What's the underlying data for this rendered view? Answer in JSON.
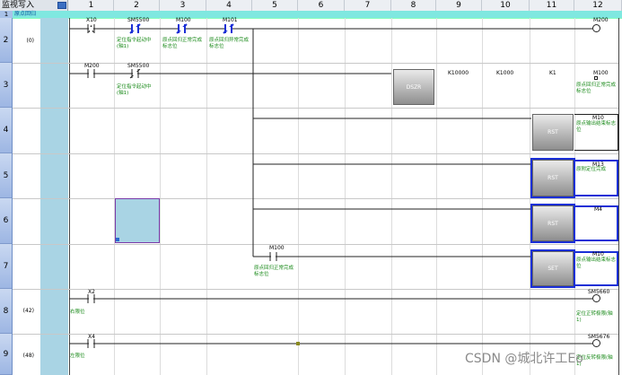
{
  "header": {
    "mode_label": "监视写入",
    "columns": [
      "1",
      "2",
      "3",
      "4",
      "5",
      "6",
      "7",
      "8",
      "9",
      "10",
      "11",
      "12"
    ]
  },
  "comment_row": {
    "num": "1",
    "text": "原点回归"
  },
  "rows": [
    {
      "num": "2",
      "step": "(0)"
    },
    {
      "num": "3",
      "step": ""
    },
    {
      "num": "4",
      "step": ""
    },
    {
      "num": "5",
      "step": ""
    },
    {
      "num": "6",
      "step": ""
    },
    {
      "num": "7",
      "step": ""
    },
    {
      "num": "8",
      "step": "(42)"
    },
    {
      "num": "9",
      "step": "(48)"
    }
  ],
  "rung2": {
    "contacts": [
      {
        "device": "X10",
        "comment": ""
      },
      {
        "device": "SM5500",
        "comment": "定位指令起动中(轴1)"
      },
      {
        "device": "M100",
        "comment": "原点回归正常完成标志位"
      },
      {
        "device": "M101",
        "comment": "原点回归异常完成标志位"
      }
    ],
    "coil": {
      "device": "M200"
    }
  },
  "rung3": {
    "contacts": [
      {
        "device": "M200",
        "comment": ""
      },
      {
        "device": "SM5500",
        "comment": "定位指令起动中(轴1)"
      }
    ],
    "instruction": "DSZR",
    "operands": [
      "K10000",
      "K1000",
      "K1",
      "M100"
    ],
    "operand_comment": "原点回归正常完成标志位"
  },
  "rung4": {
    "instruction": "RST",
    "device": "M10",
    "comment": "原点输出结束标志位"
  },
  "rung5": {
    "instruction": "RST",
    "device": "M13",
    "comment": "原附定位完成"
  },
  "rung6": {
    "instruction": "RST",
    "device": "M4",
    "comment": ""
  },
  "rung7": {
    "contact": {
      "device": "M100",
      "comment": "原点回归正常完成标志位"
    },
    "instruction": "SET",
    "device": "M10",
    "comment": "原点输出结束标志位"
  },
  "rung8": {
    "contact": {
      "device": "X2",
      "step_comment": "右限位"
    },
    "coil": {
      "device": "SM5660",
      "comment": "定位正转极限(轴1)"
    }
  },
  "rung9": {
    "contact": {
      "device": "X4",
      "step_comment": "左限位"
    },
    "coil": {
      "device": "SM5676",
      "comment": "定位反转极限(轴1)"
    }
  },
  "watermark": "CSDN @城北许工Eo",
  "colors": {
    "comment_green": "#1a8a1a",
    "selection_blue": "#1a2fd6",
    "rail_blue": "#a9d4e4"
  }
}
